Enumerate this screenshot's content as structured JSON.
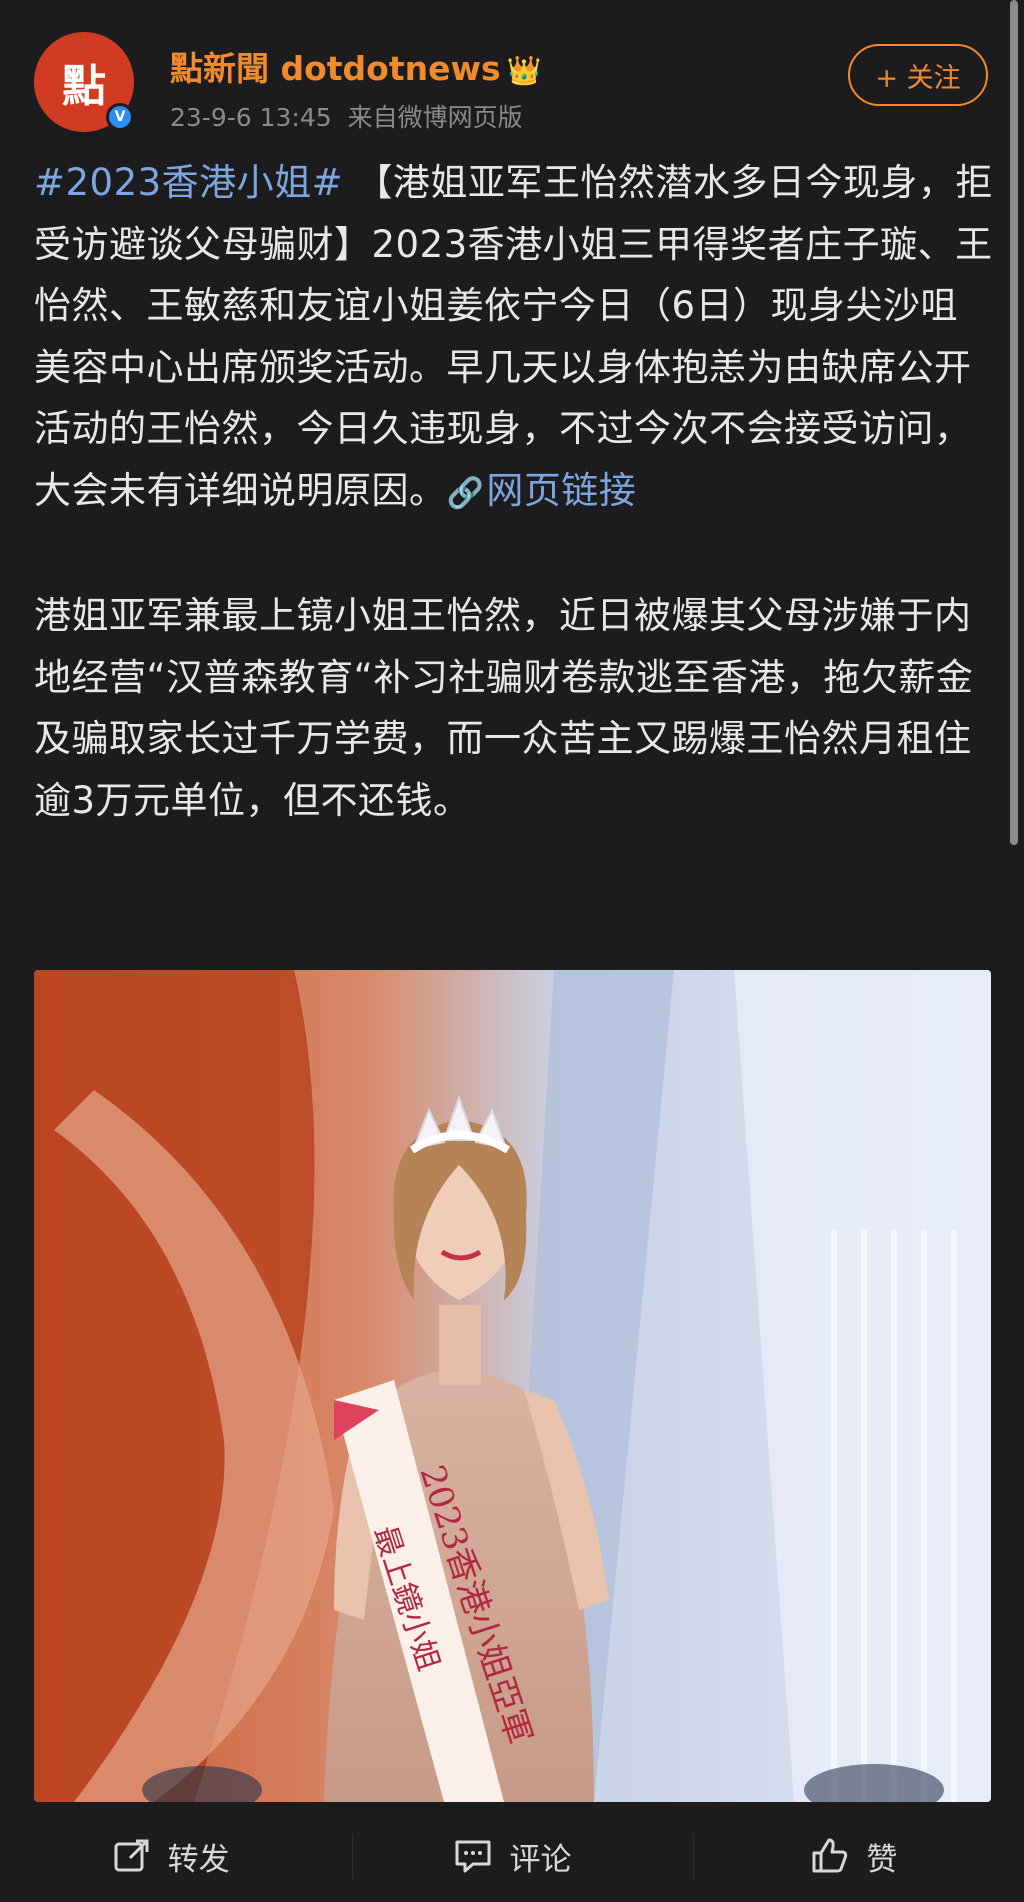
{
  "header": {
    "avatar_text": "點",
    "author_name": "點新聞 dotdotnews",
    "crown_icon": "crown-icon",
    "timestamp": "23-9-6 13:45",
    "source": "来自微博网页版",
    "follow_label": "+ 关注",
    "accent_color": "#f08a2a"
  },
  "post": {
    "hashtag": "#2023香港小姐#",
    "headline": "【港姐亚军王怡然潜水多日今现身，拒受访避谈父母骗财】",
    "body1": "2023香港小姐三甲得奖者庄子璇、王怡然、王敏慈和友谊小姐姜依宁今日（6日）现身尖沙咀美容中心出席颁奖活动。早几天以身体抱恙为由缺席公开活动的王怡然，今日久违现身，不过今次不会接受访问，大会未有详细说明原因。",
    "link_label": "网页链接",
    "body2": "港姐亚军兼最上镜小姐王怡然，近日被爆其父母涉嫌于内地经营“汉普森教育“补习社骗财卷款逃至香港，拖欠薪金及骗取家长过千万学费，而一众苦主又踢爆王怡然月租住逾3万元单位，但不还钱。",
    "link_color": "#7ea6de"
  },
  "photo": {
    "sash_text_1": "2023香港小姐亞軍",
    "sash_text_2": "最上鏡小姐"
  },
  "actions": {
    "repost": "转发",
    "comment": "评论",
    "like": "赞"
  }
}
